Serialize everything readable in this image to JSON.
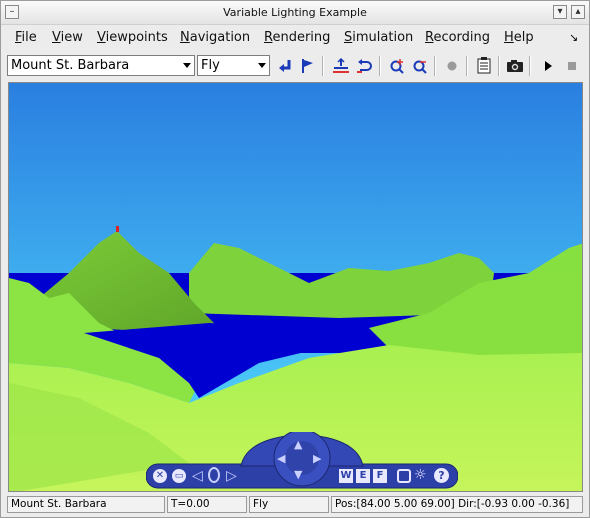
{
  "window": {
    "title": "Variable Lighting Example"
  },
  "menus": [
    "File",
    "View",
    "Viewpoints",
    "Navigation",
    "Rendering",
    "Simulation",
    "Recording",
    "Help"
  ],
  "toolbar": {
    "viewpoint_value": "Mount St. Barbara",
    "navmode_value": "Fly",
    "icons": [
      "go-to-viewpoint-icon",
      "straighten-up-icon",
      "level-icon",
      "undo-move-icon",
      "zoom-in-icon",
      "zoom-out-icon",
      "record-indicator-icon",
      "capture-text-icon",
      "camera-icon",
      "play-icon",
      "stop-icon"
    ]
  },
  "navpanel": {
    "labels": [
      "W",
      "E",
      "F",
      "?"
    ]
  },
  "status": {
    "viewpoint": "Mount St. Barbara",
    "time": "T=0.00",
    "mode": "Fly",
    "position": "Pos:[84.00 5.00 69.00] Dir:[-0.93 0.00 -0.36]"
  },
  "colors": {
    "sky_top": "#2a7fe0",
    "sky_bottom": "#55e0ff",
    "water": "#0000d0",
    "terrain": "#8fe84a",
    "nav_blue": "#2d40a8"
  }
}
